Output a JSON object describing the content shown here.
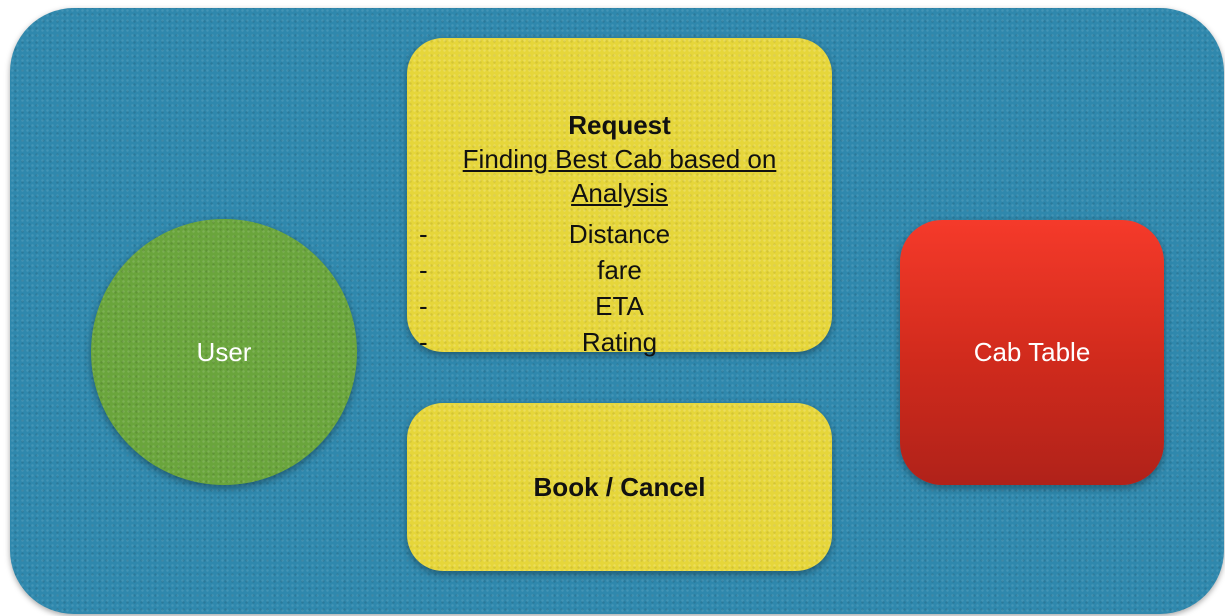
{
  "diagram": {
    "user": {
      "label": "User",
      "color": "#6aa53c"
    },
    "request": {
      "title": "Request",
      "subtitle_line1": "Finding Best Cab based on",
      "subtitle_line2": "Analysis",
      "criteria": [
        {
          "dash": "-",
          "label": "Distance"
        },
        {
          "dash": "-",
          "label": "fare"
        },
        {
          "dash": "-",
          "label": "ETA"
        },
        {
          "dash": "-",
          "label": "Rating"
        }
      ],
      "color": "#e6d63a"
    },
    "book_cancel": {
      "label": "Book / Cancel",
      "color": "#e6d63a"
    },
    "cab_table": {
      "label": "Cab Table",
      "color": "#d92e1f"
    },
    "background_color": "#2f88ad"
  }
}
